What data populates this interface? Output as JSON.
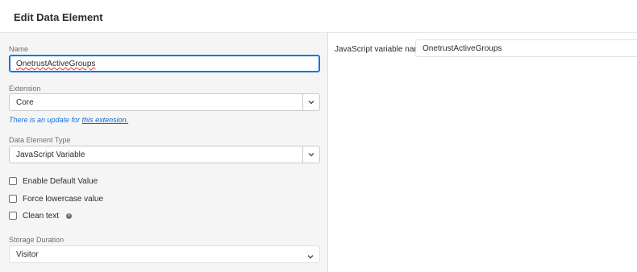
{
  "header": {
    "title": "Edit Data Element"
  },
  "form": {
    "name": {
      "label": "Name",
      "value": "OnetrustActiveGroups"
    },
    "extension": {
      "label": "Extension",
      "value": "Core"
    },
    "update_note": {
      "prefix": "There is an update for ",
      "link": "this extension."
    },
    "data_element_type": {
      "label": "Data Element Type",
      "value": "JavaScript Variable"
    },
    "checkboxes": [
      {
        "label": "Enable Default Value",
        "checked": false
      },
      {
        "label": "Force lowercase value",
        "checked": false
      },
      {
        "label": "Clean text",
        "checked": false
      }
    ],
    "storage_duration": {
      "label": "Storage Duration",
      "value": "Visitor"
    }
  },
  "settings": {
    "js_variable": {
      "label": "JavaScript variable name",
      "value": "OnetrustActiveGroups"
    }
  },
  "colors": {
    "accent": "#1473e6",
    "panel_bg": "#f5f5f5",
    "border": "#cacaca"
  },
  "icons": {
    "select_chevron": "chevron-down-icon",
    "info": "info-icon"
  }
}
